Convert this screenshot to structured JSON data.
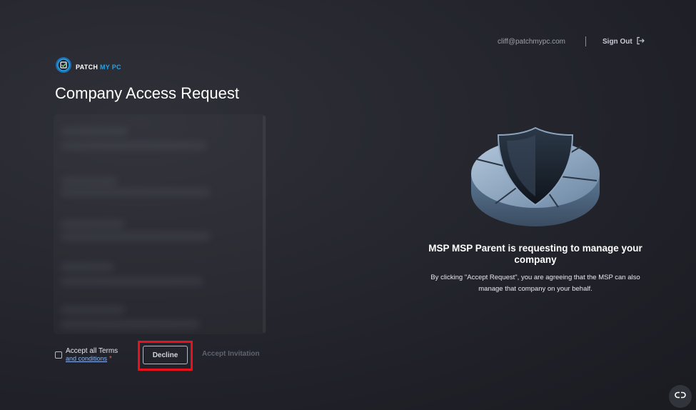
{
  "header": {
    "user_email": "cliff@patchmypc.com",
    "sign_out_label": "Sign Out"
  },
  "brand": {
    "name_part1": "PATCH",
    "name_part2": "MY PC",
    "accent_color": "#27a3e6"
  },
  "page": {
    "title": "Company Access Request"
  },
  "form": {
    "terms_label": "Accept all Terms",
    "terms_link": "and conditions",
    "required_marker": "*",
    "decline_label": "Decline",
    "accept_label": "Accept Invitation",
    "terms_checked": false
  },
  "message": {
    "title": "MSP MSP Parent is requesting to manage your company",
    "body": "By clicking \"Accept Request\", you are agreeing that the MSP can also manage that company on your behalf."
  },
  "icons": {
    "sign_out": "sign-out-icon",
    "logo": "patchmypc-logo-icon",
    "chat": "chat-widget-icon"
  },
  "colors": {
    "highlight": "#e8111c",
    "link": "#8fb4f0",
    "required": "#f05454"
  }
}
